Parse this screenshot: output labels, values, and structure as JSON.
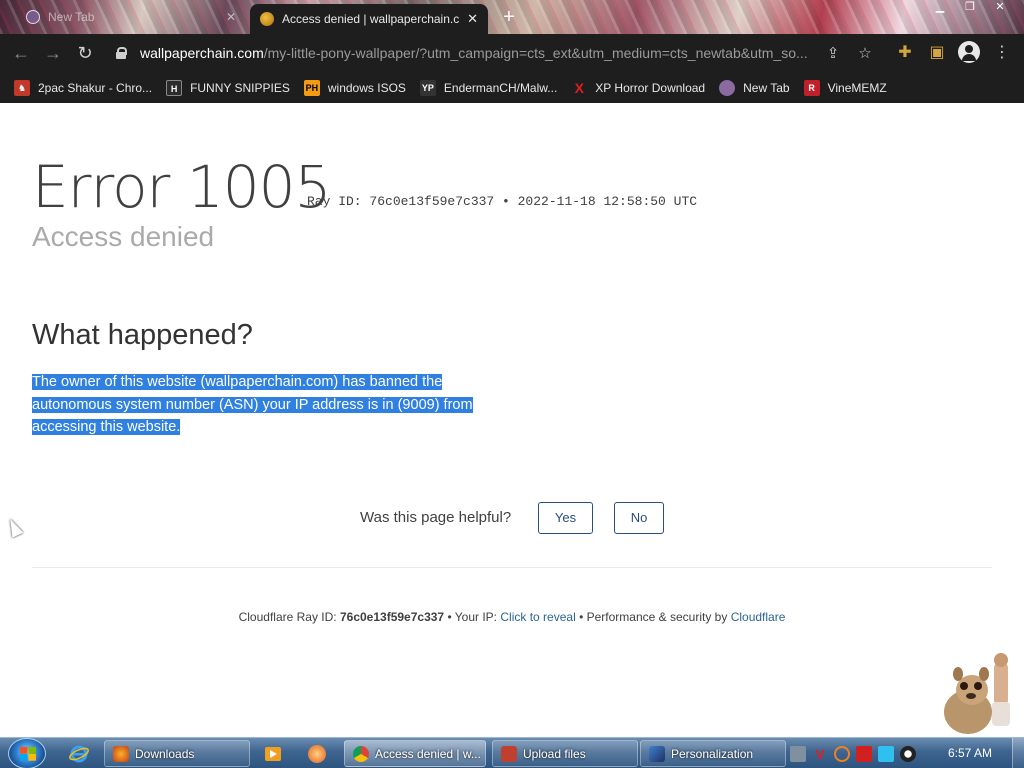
{
  "tabs": [
    {
      "title": "New Tab",
      "active": false
    },
    {
      "title": "Access denied | wallpaperchain.c",
      "active": true
    }
  ],
  "address_bar": {
    "host": "wallpaperchain.com",
    "path": "/my-little-pony-wallpaper/?utm_campaign=cts_ext&utm_medium=cts_newtab&utm_so..."
  },
  "bookmarks": [
    {
      "label": "2pac Shakur - Chro...",
      "icon": "2pac-icon",
      "color": "#c0392b"
    },
    {
      "label": "FUNNY SNIPPIES",
      "icon": "H",
      "color": "#2b2b2b"
    },
    {
      "label": "windows ISOS",
      "icon": "PH",
      "color": "#f39c12"
    },
    {
      "label": "EndermanCH/Malw...",
      "icon": "YP",
      "color": "#333333"
    },
    {
      "label": "XP Horror Download",
      "icon": "X",
      "color": "#e02020"
    },
    {
      "label": "New Tab",
      "icon": "newtab-icon",
      "color": "#8a6aa0"
    },
    {
      "label": "VineMEMZ",
      "icon": "R",
      "color": "#c0202a"
    }
  ],
  "page": {
    "error_title": "Error 1005",
    "ray_line": "Ray ID: 76c0e13f59e7c337 • 2022-11-18 12:58:50 UTC",
    "subtitle": "Access denied",
    "what_happened_heading": "What happened?",
    "what_happened_text": "The owner of this website (wallpaperchain.com) has banned the autonomous system number (ASN) your IP address is in (9009) from accessing this website.",
    "helpful_question": "Was this page helpful?",
    "yes_label": "Yes",
    "no_label": "No",
    "footer": {
      "ray_label": "Cloudflare Ray ID:",
      "ray_id": "76c0e13f59e7c337",
      "sep1": "•",
      "ip_label": "Your IP:",
      "ip_link": "Click to reveal",
      "sep2": "•",
      "perf_label": "Performance & security by",
      "cf_link": "Cloudflare"
    }
  },
  "taskbar": {
    "items": [
      {
        "label": "Downloads",
        "active": false
      },
      {
        "label": "Access denied | w...",
        "active": true
      },
      {
        "label": "Upload files",
        "active": false
      },
      {
        "label": "Personalization",
        "active": false
      }
    ],
    "clock": "6:57 AM"
  },
  "colors": {
    "selection": "#2f80e0",
    "button_border": "#2a4e80",
    "link": "#2a6496",
    "browser_chrome": "#1e1e1e"
  }
}
